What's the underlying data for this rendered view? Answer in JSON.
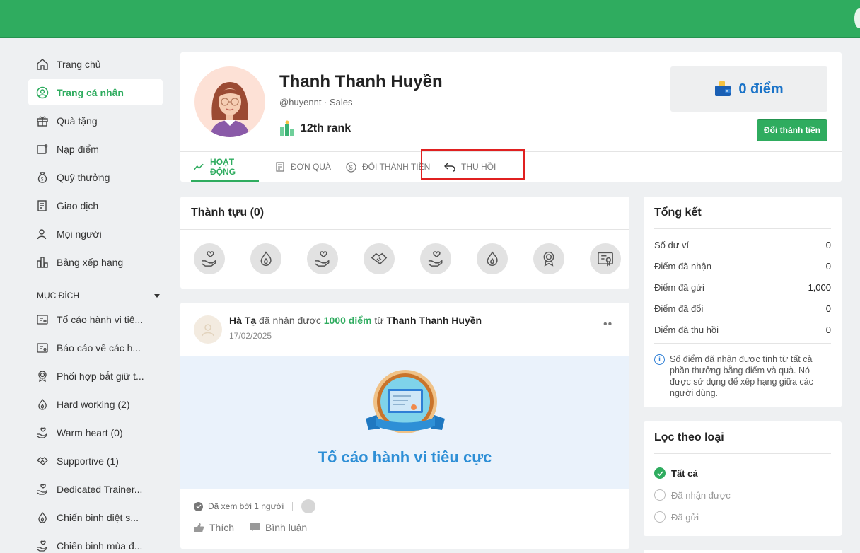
{
  "colors": {
    "brand": "#2fac5f",
    "link_blue": "#1a73c8",
    "highlight": "#e02020"
  },
  "sidebar": {
    "items": [
      {
        "label": "Trang chủ",
        "icon": "home-icon",
        "active": false
      },
      {
        "label": "Trang cá nhân",
        "icon": "user-circle-icon",
        "active": true
      },
      {
        "label": "Quà tặng",
        "icon": "gift-icon",
        "active": false
      },
      {
        "label": "Nạp điểm",
        "icon": "top-up-icon",
        "active": false
      },
      {
        "label": "Quỹ thưởng",
        "icon": "money-bag-icon",
        "active": false
      },
      {
        "label": "Giao dịch",
        "icon": "receipt-icon",
        "active": false
      },
      {
        "label": "Mọi người",
        "icon": "people-icon",
        "active": false
      },
      {
        "label": "Bảng xếp hạng",
        "icon": "leaderboard-icon",
        "active": false
      }
    ],
    "section_title": "MỤC ĐÍCH",
    "purposes": [
      {
        "label": "Tố cáo hành vi tiê...",
        "icon": "report-icon"
      },
      {
        "label": "Báo cáo về các h...",
        "icon": "report-icon"
      },
      {
        "label": "Phối hợp bắt giữ t...",
        "icon": "medal-icon"
      },
      {
        "label": "Hard working (2)",
        "icon": "fire-icon"
      },
      {
        "label": "Warm heart (0)",
        "icon": "heart-hand-icon"
      },
      {
        "label": "Supportive (1)",
        "icon": "handshake-icon"
      },
      {
        "label": "Dedicated Trainer...",
        "icon": "heart-hand-icon"
      },
      {
        "label": "Chiến binh diệt s...",
        "icon": "fire-icon"
      },
      {
        "label": "Chiến binh mùa đ...",
        "icon": "heart-hand-icon"
      }
    ]
  },
  "profile": {
    "name": "Thanh Thanh Huyền",
    "subtitle": "@huyennt · Sales",
    "rank": "12th rank",
    "points": "0 điểm",
    "convert_button": "Đổi thành tiền",
    "tabs": [
      {
        "label": "HOẠT ĐỘNG",
        "icon": "activity-icon",
        "active": true
      },
      {
        "label": "ĐƠN QUÀ",
        "icon": "gift-order-icon",
        "active": false
      },
      {
        "label": "ĐỔI THÀNH TIỀN",
        "icon": "dollar-icon",
        "active": false
      },
      {
        "label": "THU HỒI",
        "icon": "undo-icon",
        "active": false
      }
    ]
  },
  "achievements": {
    "title": "Thành tựu (0)",
    "badges": [
      "heart-hand-icon",
      "fire-icon",
      "heart-hand-icon",
      "handshake-icon",
      "heart-hand-icon",
      "fire-icon",
      "medal-icon",
      "certificate-icon"
    ]
  },
  "post": {
    "actor": "Hà Tạ",
    "verb": " đã nhận được ",
    "points": "1000 điểm",
    "from": " từ ",
    "target": "Thanh Thanh Huyền",
    "date": "17/02/2025",
    "more": "••",
    "banner_title": "Tố cáo hành vi tiêu cực",
    "seen_text": "Đã xem bởi 1 người",
    "like_label": "Thích",
    "comment_label": "Bình luận"
  },
  "summary": {
    "title": "Tổng kết",
    "rows": [
      {
        "label": "Số dư ví",
        "value": "0"
      },
      {
        "label": "Điểm đã nhận",
        "value": "0"
      },
      {
        "label": "Điểm đã gửi",
        "value": "1,000"
      },
      {
        "label": "Điểm đã đổi",
        "value": "0"
      },
      {
        "label": "Điểm đã thu hồi",
        "value": "0"
      }
    ],
    "note_icon": "i",
    "note": "Số điểm đã nhận được tính từ tất cả phần thưởng bằng điểm và quà. Nó được sử dụng để xếp hạng giữa các người dùng."
  },
  "filter": {
    "title": "Lọc theo loại",
    "options": [
      {
        "label": "Tất cả",
        "checked": true
      },
      {
        "label": "Đã nhận được",
        "checked": false
      },
      {
        "label": "Đã gửi",
        "checked": false
      }
    ]
  }
}
